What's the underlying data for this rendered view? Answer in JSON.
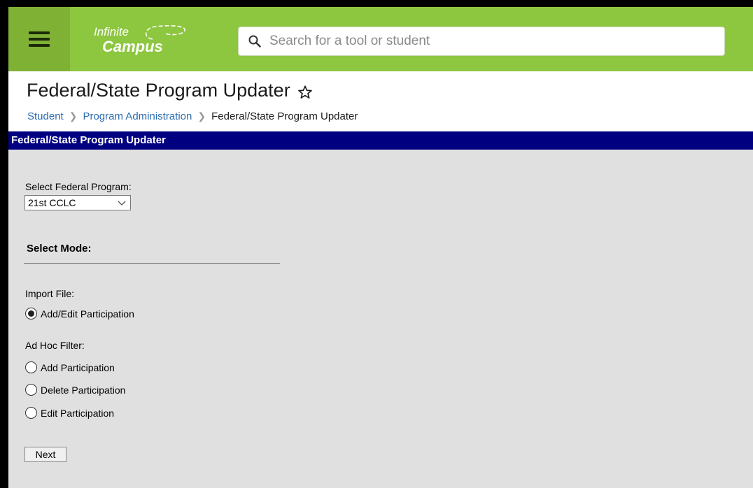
{
  "app": {
    "logo_line1": "Infinite",
    "logo_line2": "Campus",
    "accent_color": "#8dc63f",
    "section_bar_color": "#000080"
  },
  "search": {
    "placeholder": "Search for a tool or student",
    "value": ""
  },
  "header": {
    "title": "Federal/State Program Updater",
    "breadcrumb": [
      "Student",
      "Program Administration",
      "Federal/State Program Updater"
    ]
  },
  "section": {
    "title": "Federal/State Program Updater"
  },
  "form": {
    "federal_program_label": "Select Federal Program:",
    "federal_program_value": "21st CCLC",
    "mode_title": "Select Mode:",
    "import_file_label": "Import File:",
    "import_options": [
      {
        "label": "Add/Edit Participation",
        "checked": true
      }
    ],
    "adhoc_label": "Ad Hoc Filter:",
    "adhoc_options": [
      {
        "label": "Add Participation",
        "checked": false
      },
      {
        "label": "Delete Participation",
        "checked": false
      },
      {
        "label": "Edit Participation",
        "checked": false
      }
    ],
    "next_label": "Next"
  }
}
